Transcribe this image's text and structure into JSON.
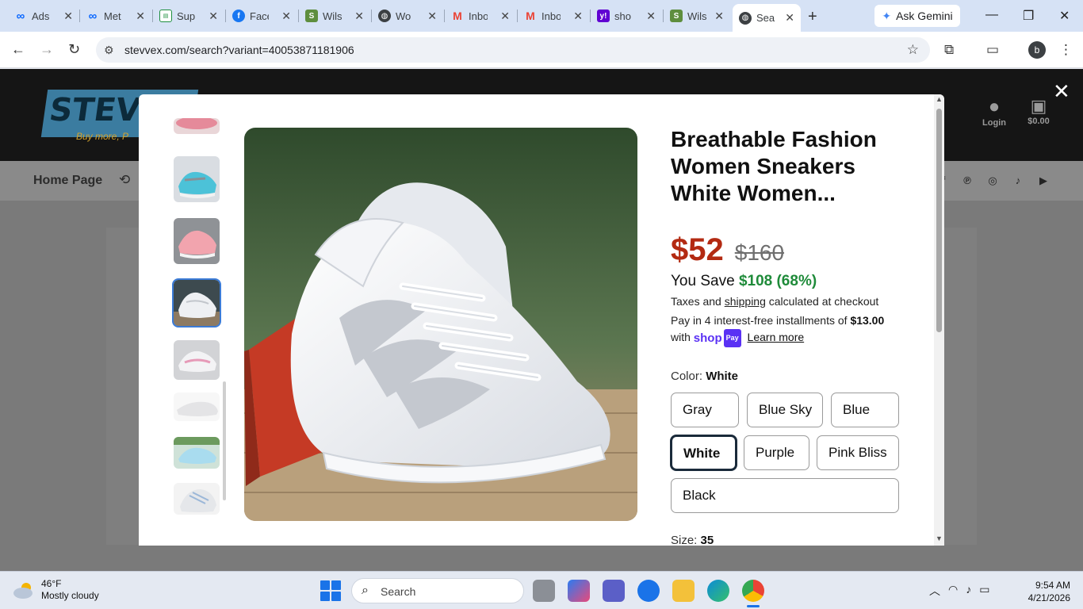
{
  "browser": {
    "tabs": [
      {
        "label": "Ads",
        "favicon": "meta-icon",
        "color": "#0866ff"
      },
      {
        "label": "Met",
        "favicon": "meta-icon",
        "color": "#0866ff"
      },
      {
        "label": "Sup",
        "favicon": "sheet-icon",
        "color": "#1e8e3e"
      },
      {
        "label": "Face",
        "favicon": "facebook-icon",
        "color": "#1877f2"
      },
      {
        "label": "Wils",
        "favicon": "shopify-icon",
        "color": "#5e8e3e"
      },
      {
        "label": "Wo",
        "favicon": "globe-icon",
        "color": "#3c4043"
      },
      {
        "label": "Inbo",
        "favicon": "gmail-icon",
        "color": "#ea4335"
      },
      {
        "label": "Inbo",
        "favicon": "gmail-icon",
        "color": "#ea4335"
      },
      {
        "label": "sho",
        "favicon": "yahoo-icon",
        "color": "#6001d2"
      },
      {
        "label": "Wils",
        "favicon": "shopify-icon",
        "color": "#5e8e3e"
      },
      {
        "label": "Sea",
        "favicon": "globe-icon",
        "color": "#3c4043",
        "active": true
      }
    ],
    "gemini_label": "Ask Gemini",
    "url": "stevvex.com/search?variant=40053871181906",
    "profile_initial": "b"
  },
  "site": {
    "logo_text": "STEVV",
    "logo_tagline": "Buy more, P",
    "nav_home": "Home Page",
    "login_label": "Login",
    "cart_label": "$0.00"
  },
  "product": {
    "title": "Breathable Fashion Women Sneakers White Women...",
    "price": "$52",
    "compare_price": "$160",
    "you_save_label": "You Save",
    "you_save_amount": "$108 (68%)",
    "tax_pre": "Taxes and",
    "tax_link": "shipping",
    "tax_post": "calculated at checkout",
    "installment_pre": "Pay in 4 interest-free installments of",
    "installment_amount": "$13.00",
    "installment_with": "with",
    "shoppay_brand": "shop",
    "shoppay_pay": "Pay",
    "learn_more": "Learn more",
    "color_label": "Color:",
    "color_selected": "White",
    "colors": [
      "Gray",
      "Blue Sky",
      "Blue",
      "White",
      "Purple",
      "Pink Bliss",
      "Black"
    ],
    "size_label": "Size:",
    "size_selected": "35"
  },
  "taskbar": {
    "weather_temp": "46°F",
    "weather_desc": "Mostly cloudy",
    "search_label": "Search",
    "time": "9:54 AM",
    "date": "4/21/2026"
  }
}
